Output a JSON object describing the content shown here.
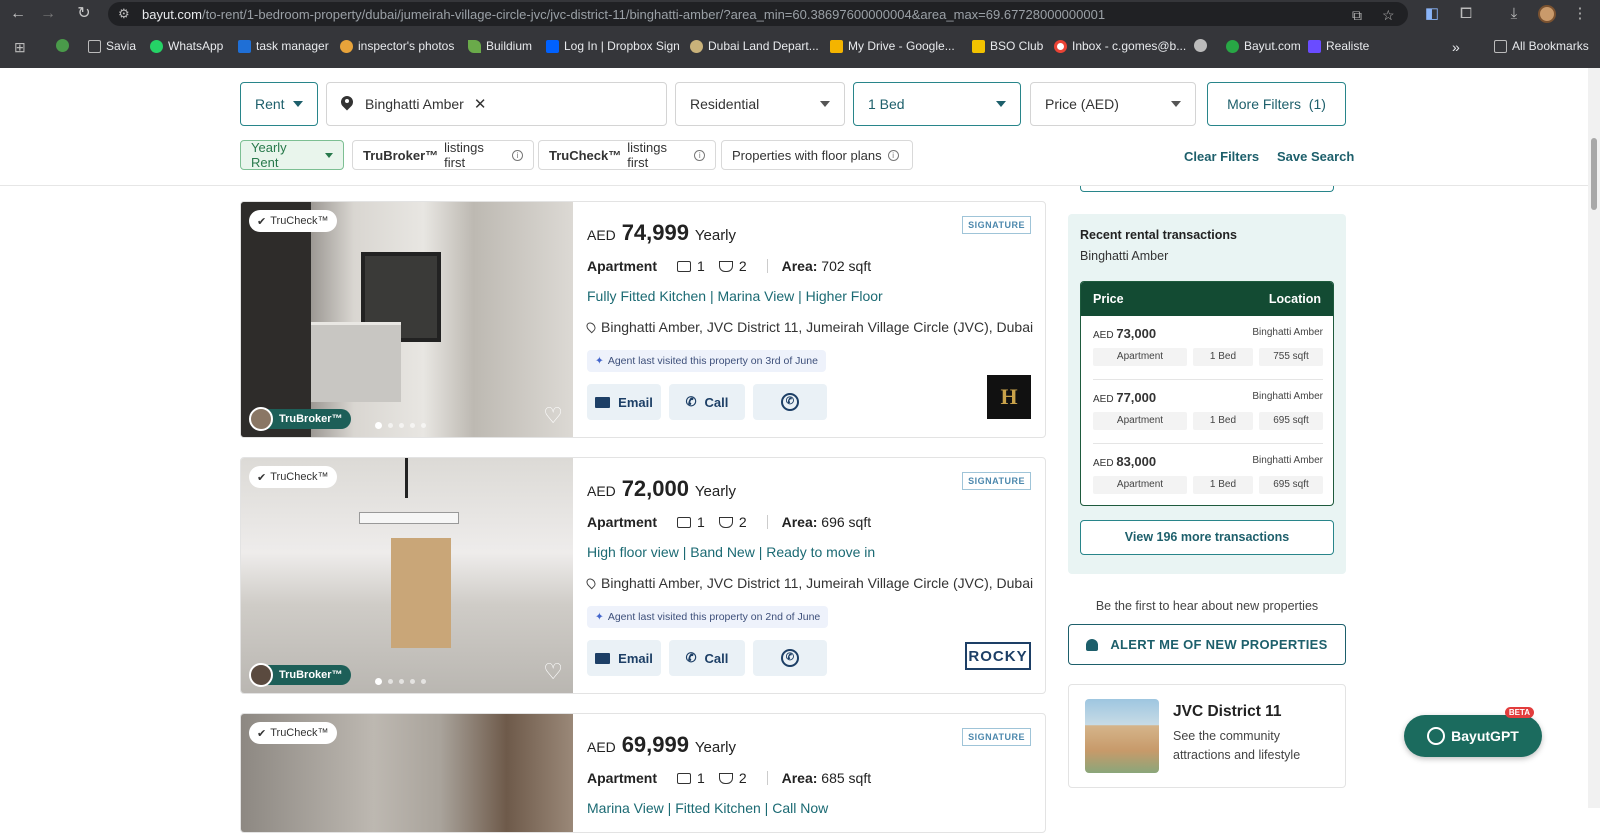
{
  "browser": {
    "url_host": "bayut.com",
    "url_path": "/to-rent/1-bedroom-property/dubai/jumeirah-village-circle-jvc/jvc-district-11/binghatti-amber/?area_min=60.38697600000004&area_max=69.67728000000001",
    "bookmarks": [
      "Savia",
      "WhatsApp",
      "task manager",
      "inspector's photos",
      "Buildium",
      "Log In | Dropbox Sign",
      "Dubai Land Depart...",
      "My Drive - Google...",
      "BSO Club",
      "Inbox - c.gomes@b...",
      "Bayut.com",
      "Realiste",
      "All Bookmarks"
    ],
    "more_bookmarks": "»"
  },
  "filters": {
    "purpose": "Rent",
    "location_chip": "Binghatti Amber",
    "category": "Residential",
    "beds": "1 Bed",
    "price": "Price (AED)",
    "more_filters": "More Filters",
    "more_filters_count": "(1)",
    "rent_freq": "Yearly Rent",
    "trubroker_bold": "TruBroker™",
    "trubroker_rest": "listings first",
    "trucheck_bold": "TruCheck™",
    "trucheck_rest": "listings first",
    "floorplans": "Properties with floor plans",
    "clear": "Clear Filters",
    "save": "Save Search"
  },
  "listings": [
    {
      "trucheck": "TruCheck™",
      "agent_badge": "TruBroker™",
      "currency": "AED",
      "price": "74,999",
      "period": "Yearly",
      "signature": "SIGNATURE",
      "type": "Apartment",
      "beds": "1",
      "baths": "2",
      "area_label": "Area:",
      "area": "702 sqft",
      "headline": "Fully Fitted Kitchen | Marina View | Higher Floor",
      "location": "Binghatti Amber, JVC District 11, Jumeirah Village Circle (JVC), Dubai",
      "visit": "Agent last visited this property on 3rd of June",
      "email": "Email",
      "call": "Call"
    },
    {
      "trucheck": "TruCheck™",
      "agent_badge": "TruBroker™",
      "currency": "AED",
      "price": "72,000",
      "period": "Yearly",
      "signature": "SIGNATURE",
      "type": "Apartment",
      "beds": "1",
      "baths": "2",
      "area_label": "Area:",
      "area": "696 sqft",
      "headline": "High floor view | Band New | Ready to move in",
      "location": "Binghatti Amber, JVC District 11, Jumeirah Village Circle (JVC), Dubai",
      "visit": "Agent last visited this property on 2nd of June",
      "email": "Email",
      "call": "Call",
      "agency_logo": "ROCKY"
    },
    {
      "trucheck": "TruCheck™",
      "currency": "AED",
      "price": "69,999",
      "period": "Yearly",
      "signature": "SIGNATURE",
      "type": "Apartment",
      "beds": "1",
      "baths": "2",
      "area_label": "Area:",
      "area": "685 sqft",
      "headline": "Marina View | Fitted Kitchen | Call Now"
    }
  ],
  "sidebar": {
    "title": "Recent rental transactions",
    "subtitle": "Binghatti Amber",
    "col_price": "Price",
    "col_location": "Location",
    "transactions": [
      {
        "currency": "AED",
        "price": "73,000",
        "location": "Binghatti Amber",
        "type": "Apartment",
        "beds": "1 Bed",
        "area": "755 sqft"
      },
      {
        "currency": "AED",
        "price": "77,000",
        "location": "Binghatti Amber",
        "type": "Apartment",
        "beds": "1 Bed",
        "area": "695 sqft"
      },
      {
        "currency": "AED",
        "price": "83,000",
        "location": "Binghatti Amber",
        "type": "Apartment",
        "beds": "1 Bed",
        "area": "695 sqft"
      }
    ],
    "more_btn": "View 196 more transactions",
    "first_hear": "Be the first to hear about new properties",
    "alert_btn": "ALERT ME OF NEW PROPERTIES",
    "community_title": "JVC District 11",
    "community_sub": "See the community attractions and lifestyle"
  },
  "gpt": {
    "label": "BayutGPT",
    "beta": "BETA"
  },
  "colors": {
    "brand": "#28858a",
    "dark_green": "#134b33",
    "link": "#1d5f6b"
  }
}
